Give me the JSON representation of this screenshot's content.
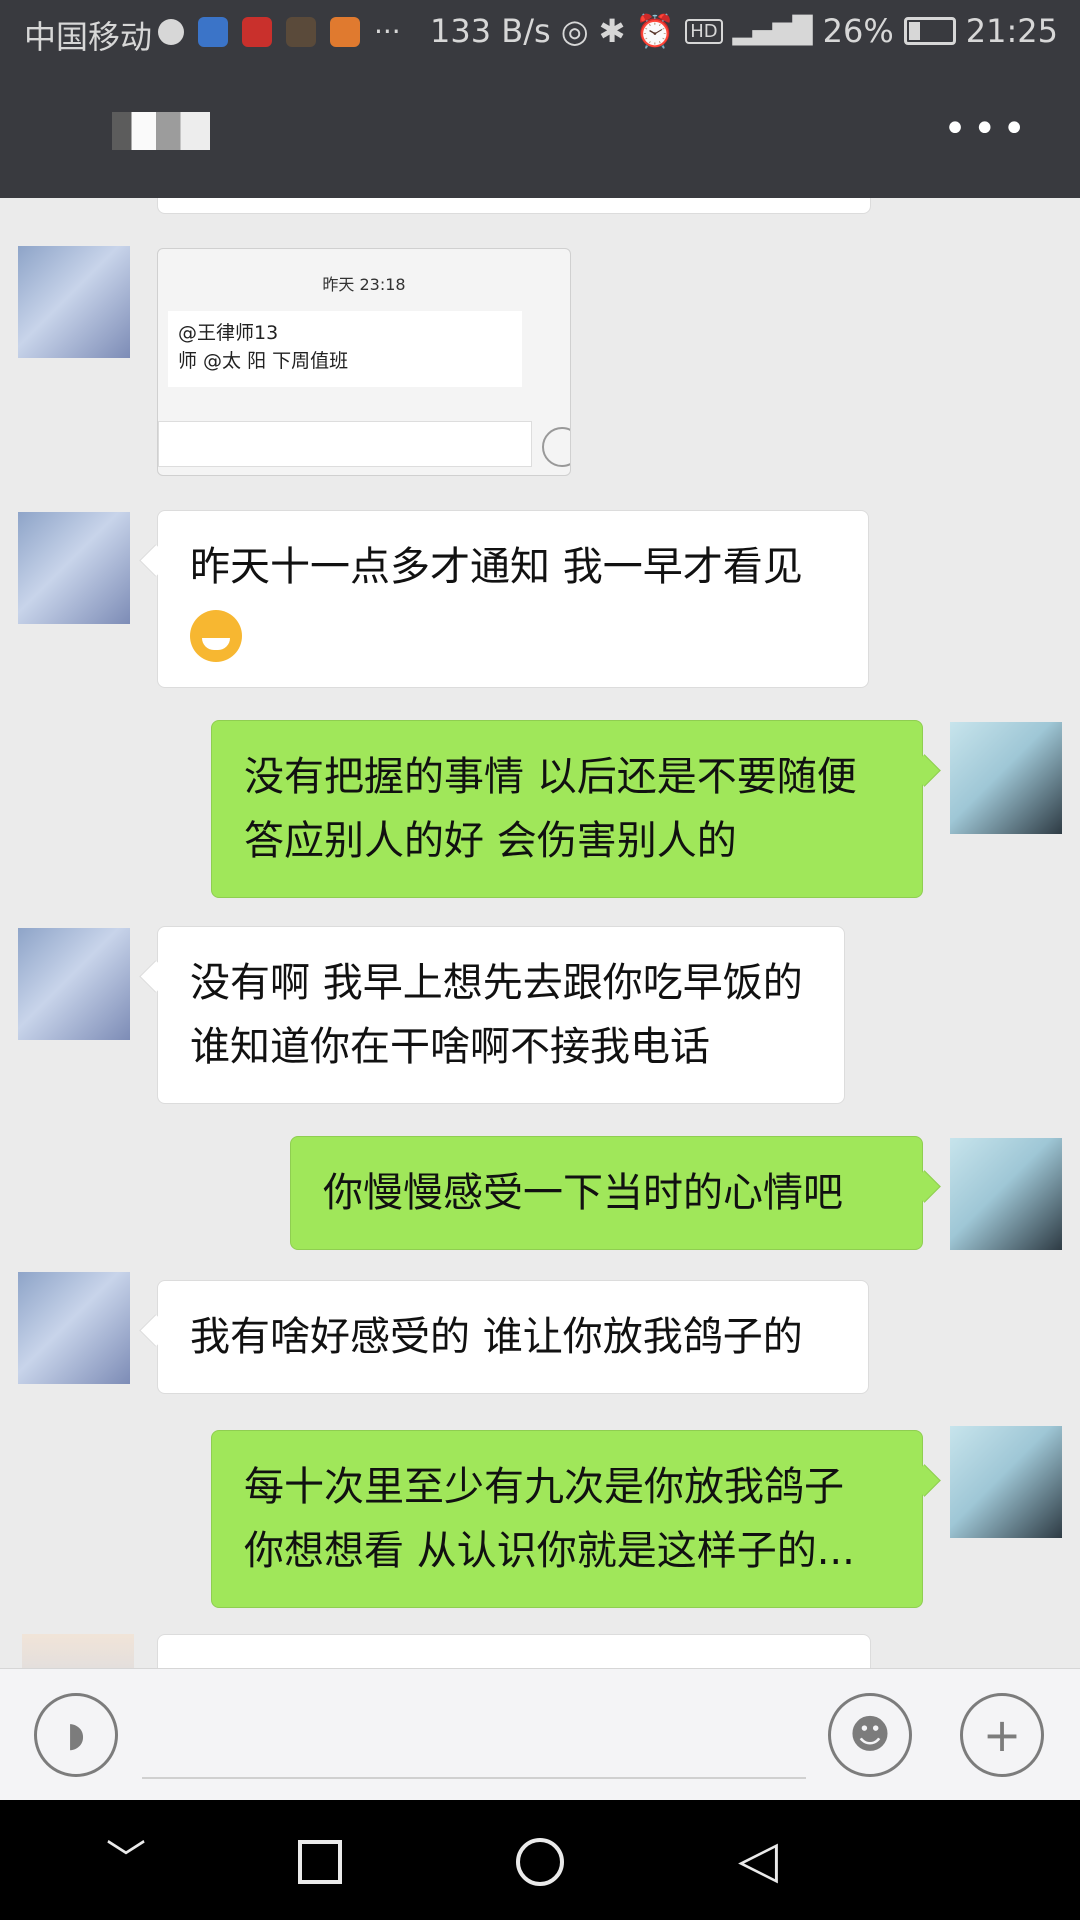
{
  "status_bar": {
    "carrier": "中国移动",
    "net_speed": "133 B/s",
    "hd": "HD",
    "battery": "26%",
    "time": "21:25"
  },
  "header": {
    "more_icon": "more-dots-icon"
  },
  "image_card": {
    "timestamp": "昨天 23:18",
    "text_line1": "@王律师13",
    "text_line2": "师 @太 阳 下周值班"
  },
  "messages": [
    {
      "side": "left",
      "text": "昨天十一点多才通知 我一早才看见",
      "emoji": "grin-emoji"
    },
    {
      "side": "right",
      "text": "没有把握的事情 以后还是不要随便答应别人的好 会伤害别人的"
    },
    {
      "side": "left",
      "text": "没有啊 我早上想先去跟你吃早饭的 谁知道你在干啥啊不接我电话"
    },
    {
      "side": "right",
      "text": "你慢慢感受一下当时的心情吧"
    },
    {
      "side": "left",
      "text": "我有啥好感受的 谁让你放我鸽子的"
    },
    {
      "side": "right",
      "text": "每十次里至少有九次是你放我鸽子 你想想看 从认识你就是这样子的..."
    }
  ],
  "input_bar": {
    "voice_icon": "voice-icon",
    "emoji_icon": "emoji-face-icon",
    "plus_icon": "plus-icon"
  },
  "colors": {
    "bar": "#393a3f",
    "chat_bg": "#ebebeb",
    "bubble_self": "#a0e75a",
    "bubble_other": "#ffffff"
  }
}
